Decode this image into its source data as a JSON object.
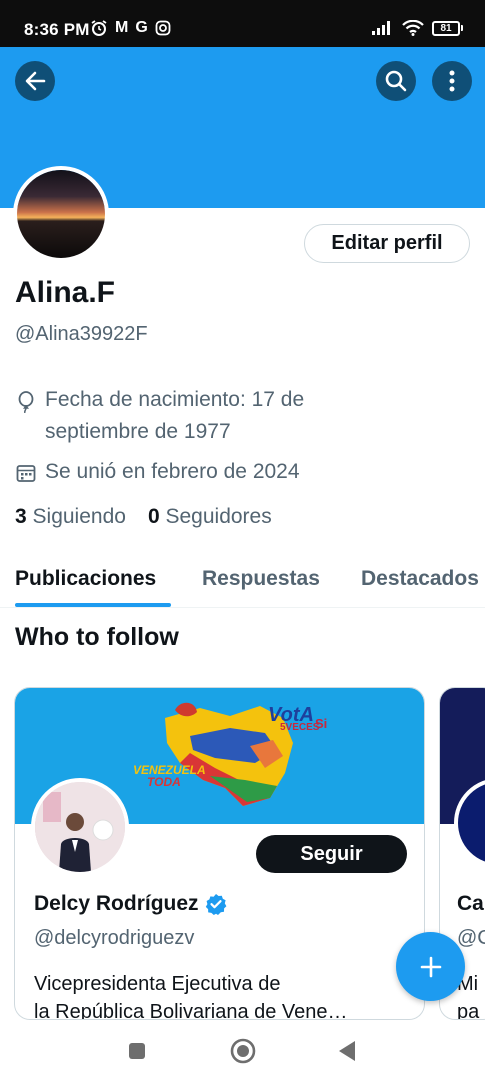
{
  "status_bar": {
    "time": "8:36 PM",
    "notif_icons": [
      "alarm-icon",
      "gmail-icon",
      "google-icon",
      "instagram-icon"
    ],
    "gmail_glyph": "M",
    "google_glyph": "G",
    "battery": "81"
  },
  "header": {
    "back_icon": "back-arrow-icon",
    "search_icon": "search-icon",
    "more_icon": "more-vertical-icon",
    "banner_color": "#1d9bf0"
  },
  "profile": {
    "edit_label": "Editar perfil",
    "name": "Alina.F",
    "handle": "@Alina39922F",
    "birth_line1": "Fecha de nacimiento: 17 de",
    "birth_line2": "septiembre de 1977",
    "joined": "Se unió en febrero de 2024",
    "following_count": "3",
    "following_label": "Siguiendo",
    "followers_count": "0",
    "followers_label": "Seguidores"
  },
  "tabs": [
    "Publicaciones",
    "Respuestas",
    "Destacados"
  ],
  "who_to_follow": {
    "title": "Who to follow",
    "cards": [
      {
        "name": "Delcy Rodríguez",
        "handle": "@delcyrodriguezv",
        "bio_line1": "Vicepresidenta Ejecutiva de",
        "bio_line2": "la República Bolivariana de Vene…",
        "follow_label": "Seguir",
        "verified": true,
        "banner_text_vota": "VotA",
        "banner_text_veces": "5VECES",
        "banner_text_si": "Si",
        "banner_text_venezuela": "VENEZUELA",
        "banner_text_toda": "TODA"
      },
      {
        "name": "Ca",
        "handle": "@C",
        "bio_line1": "Mi",
        "bio_line2": "pa"
      }
    ]
  },
  "fab_icon": "plus-icon",
  "nav": [
    "recents-icon",
    "home-icon",
    "back-icon"
  ],
  "colors": {
    "accent": "#1d9bf0",
    "text_primary": "#0f1419",
    "text_secondary": "#536471"
  }
}
